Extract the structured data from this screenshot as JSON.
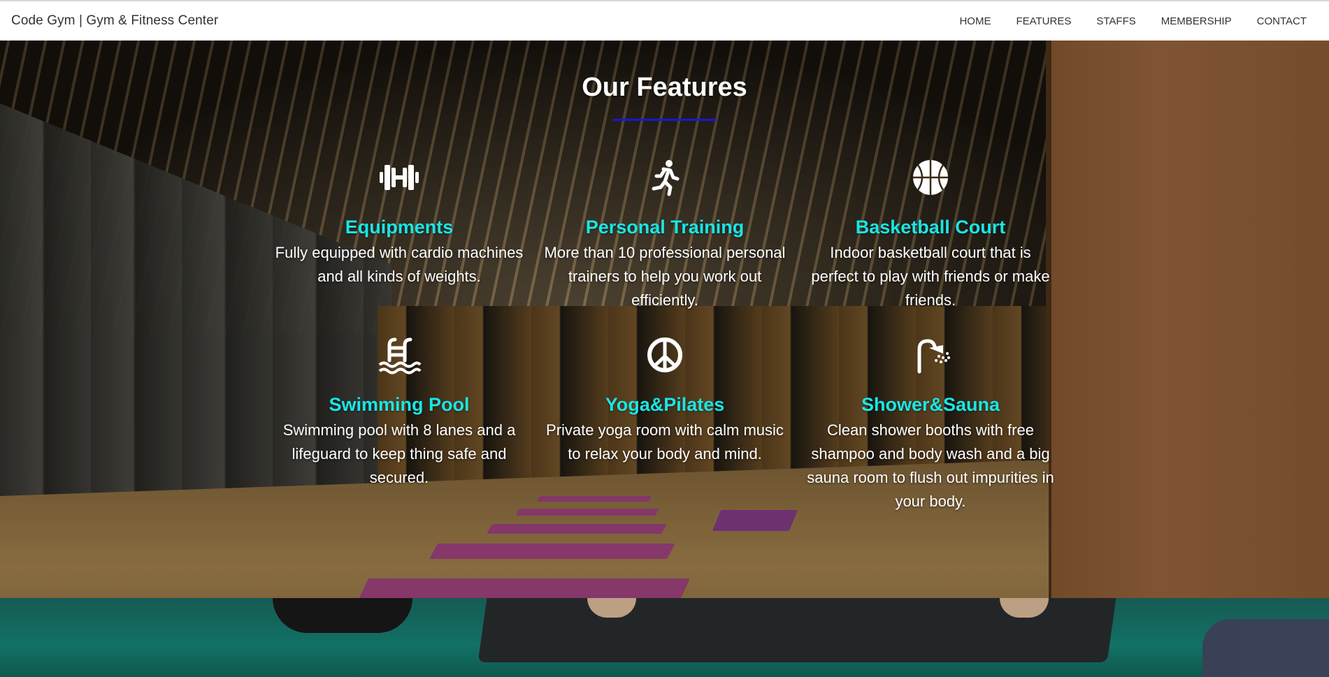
{
  "navbar": {
    "brand": "Code Gym | Gym & Fitness Center",
    "links": [
      "HOME",
      "FEATURES",
      "STAFFS",
      "MEMBERSHIP",
      "CONTACT"
    ]
  },
  "features_section": {
    "title": "Our Features",
    "accent_color": "#19e6e6",
    "underline_color": "#1a17d8",
    "items": [
      {
        "icon": "dumbbell-icon",
        "title": "Equipments",
        "text": "Fully equipped with cardio machines and all kinds of weights."
      },
      {
        "icon": "running-icon",
        "title": "Personal Training",
        "text": "More than 10 professional personal trainers to help you work out efficiently."
      },
      {
        "icon": "basketball-icon",
        "title": "Basketball Court",
        "text": "Indoor basketball court that is perfect to play with friends or make friends."
      },
      {
        "icon": "swimming-pool-icon",
        "title": "Swimming Pool",
        "text": "Swimming pool with 8 lanes and a lifeguard to keep thing safe and secured."
      },
      {
        "icon": "peace-icon",
        "title": "Yoga&Pilates",
        "text": "Private yoga room with calm music to relax your body and mind."
      },
      {
        "icon": "shower-icon",
        "title": "Shower&Sauna",
        "text": "Clean shower booths with free shampoo and body wash and a big sauna room to flush out impurities in your body."
      }
    ]
  }
}
